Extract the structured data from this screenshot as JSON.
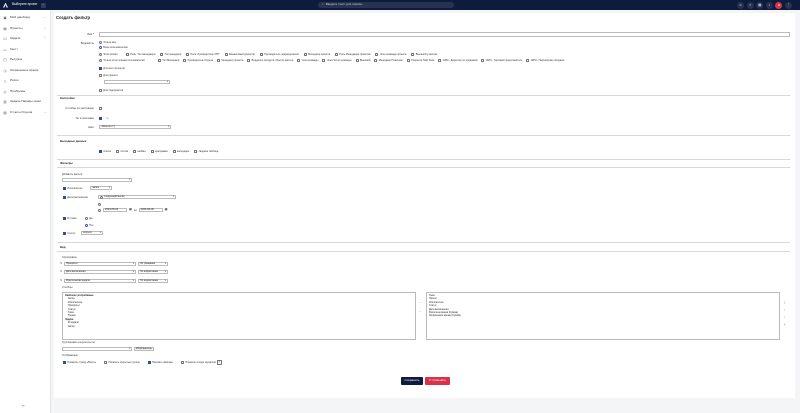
{
  "topbar": {
    "project": "Выберите проект",
    "search_placeholder": "Введите текст для поиска..."
  },
  "sidebar": {
    "items": [
      {
        "label": "Мой дашборд",
        "icon": "dashboard-icon"
      },
      {
        "label": "Проекты",
        "icon": "projects-icon"
      },
      {
        "label": "Задачи",
        "icon": "tasks-icon"
      },
      {
        "label": "Гантт",
        "icon": "gantt-icon"
      },
      {
        "label": "Ресурсы",
        "icon": "resources-icon"
      },
      {
        "label": "Затраченное время",
        "icon": "time-icon"
      },
      {
        "label": "Риски",
        "icon": "risks-icon"
      },
      {
        "label": "Проблемы",
        "icon": "problems-icon"
      },
      {
        "label": "Задачи Наряды чаши",
        "icon": "orders-icon"
      },
      {
        "label": "Отчеты Отдела",
        "icon": "reports-icon"
      }
    ]
  },
  "form": {
    "title": "Создать фильтр",
    "name_label": "Имя *",
    "visibility_label": "Видимость",
    "vis": [
      "Только мне",
      "Всем пользователям",
      "Этим ролям:",
      "Только этим членам пользователей"
    ],
    "roles": [
      "Роль: Тип менеджера",
      "Тип менеджер",
      "Роль: Руководитель ОНТ",
      "Финансовый директор",
      "Руководитель подразделения",
      "Менеджер проекта",
      "Роль Менеджера проектов",
      "Член команды проекта",
      "Внешний участник",
      "Тип Менеджер",
      "Руководитель Отдела",
      "Менеджер проекта",
      "Владелец продукта / Бэклог-мастер",
      "Член команды",
      "Член Scrum команды",
      "Внешний",
      "Менеджер Новичков",
      "Оператор Help Desk",
      "CRM - Директор по продажам",
      "CRM - Торговый представитель",
      "CRM - Партнёрские продажи"
    ],
    "for_all_projects": "Для всех проектов",
    "for_project": "Для проекта",
    "for_subprojects": "Для подпроектов",
    "settings": "Настройки",
    "stolbcy": "Столбцы по умолчанию",
    "tags": "Тег в заголовке",
    "color_label": "Цвет",
    "color_value": "таблетки (Y)",
    "output": "Выходные данные",
    "outputs": [
      "список",
      "плитки",
      "канбан",
      "диаграмма",
      "календарь",
      "сводная таблица"
    ],
    "filters": "Фильтры",
    "add_filter": "Добавить фильтр",
    "f_exec": "Исполнитель",
    "f_exec_op": "любое",
    "f_date": "Дата выполнения",
    "f_date_op": "следующий месяц",
    "from": "2024-06-01",
    "to_lbl": "по",
    "to": "2024-06-30",
    "f_inplan": "В плане",
    "yes": "Да",
    "no": "Нет",
    "f_status": "Статус",
    "status_op": "открыто",
    "sort_sec": "Вид",
    "sort_lbl": "Сортировать",
    "sorts": [
      [
        "Приоритет",
        "По убыванию"
      ],
      [
        "Дата выполнения",
        "По возрастанию"
      ],
      [
        "Родительская задача",
        "По возрастанию"
      ]
    ],
    "cols_lbl": "Столбцы",
    "avail_head": "Наиболее употребимые",
    "avail": [
      "Автор",
      "Исполнитель",
      "Приоритет",
      "Статус",
      "Тема",
      "Трекер"
    ],
    "avail2_head": "Задача",
    "avail2": [
      "ID задачи",
      "Автор"
    ],
    "selected": [
      "Тема",
      "Проект",
      "Исполнитель",
      "Статус",
      "Дата выполнения",
      "Расчётное время (Сумма)",
      "Затраченное время (Сумма)"
    ],
    "group_lbl": "Группировать результаты по",
    "grp_btn": "Исполнитель",
    "show_lbl": "Отображение",
    "shows": [
      "Показать строку «Всего»",
      "Показать открытые группы",
      "Показать аватары",
      "Показать в виде иерархии"
    ],
    "save": "Сохранить",
    "cancel": "Отменить"
  }
}
